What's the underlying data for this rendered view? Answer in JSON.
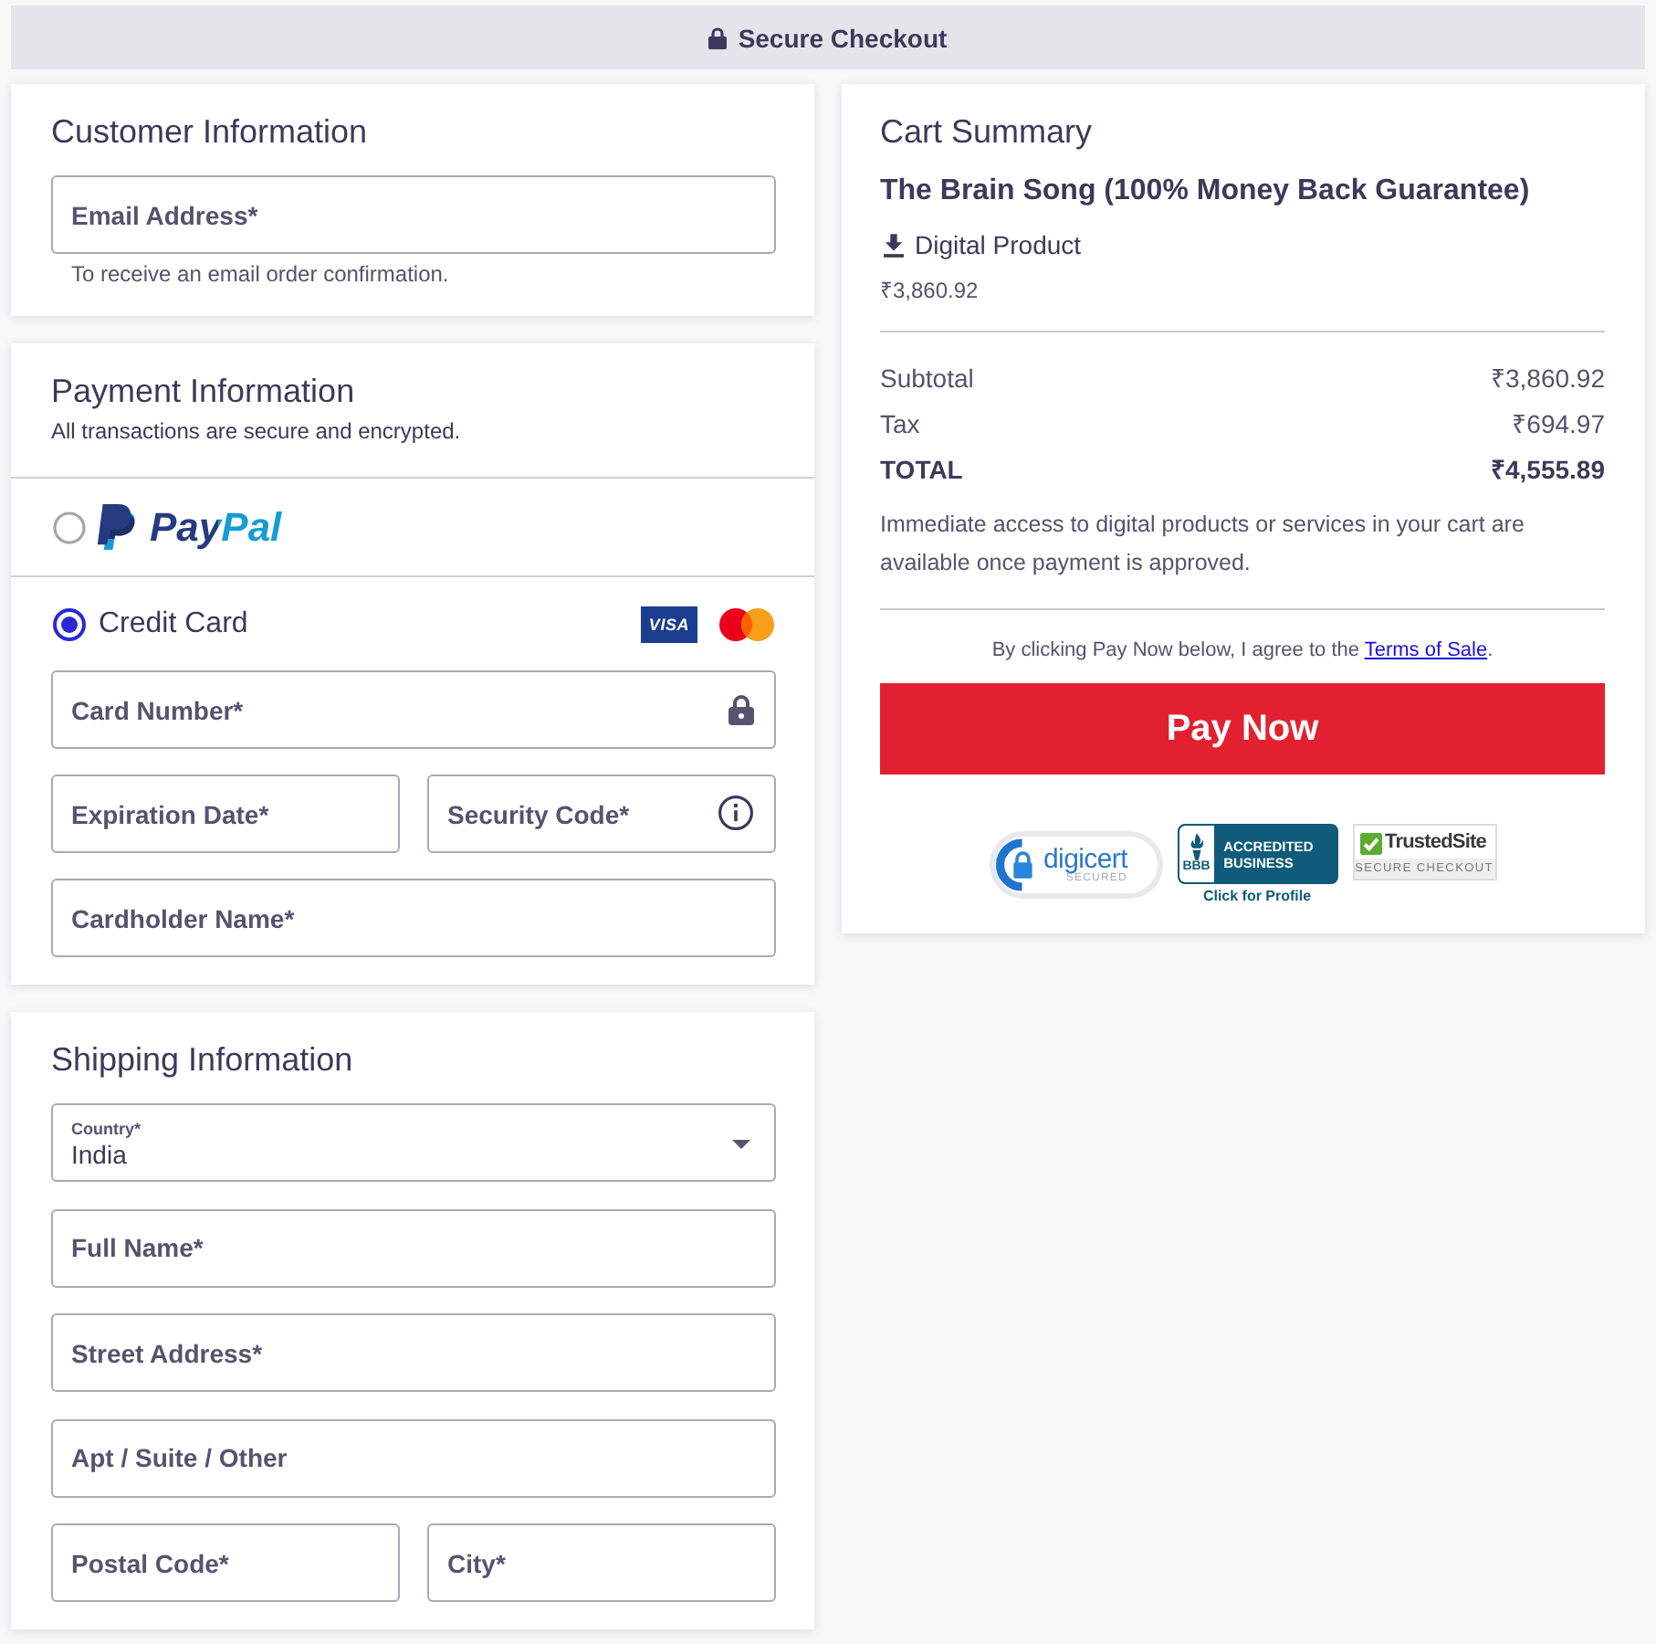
{
  "header": {
    "title": "Secure Checkout"
  },
  "customer": {
    "title": "Customer Information",
    "rows": [
      {
        "fields": [
          {
            "kind": "text",
            "placeholder": "Email Address*"
          }
        ]
      }
    ],
    "hint": "To receive an email order confirmation."
  },
  "payment": {
    "title": "Payment Information",
    "subtitle": "All transactions are secure and encrypted.",
    "methods": [
      {
        "kind": "paypal",
        "label": "PayPal",
        "selected": false
      },
      {
        "kind": "card",
        "label": "Credit Card",
        "selected": true,
        "brands": [
          {
            "kind": "visa",
            "label": "VISA"
          },
          {
            "kind": "mastercard"
          }
        ],
        "rows": [
          {
            "fields": [
              {
                "kind": "card_number",
                "placeholder": "Card Number*"
              }
            ]
          },
          {
            "fields": [
              {
                "kind": "text",
                "placeholder": "Expiration Date*"
              },
              {
                "kind": "security_code",
                "placeholder": "Security Code*"
              }
            ]
          },
          {
            "fields": [
              {
                "kind": "text",
                "placeholder": "Cardholder Name*"
              }
            ]
          }
        ]
      }
    ]
  },
  "shipping": {
    "title": "Shipping Information",
    "rows": [
      {
        "fields": [
          {
            "kind": "select",
            "label": "Country*",
            "value": "India"
          }
        ]
      },
      {
        "fields": [
          {
            "kind": "text",
            "placeholder": "Full Name*"
          }
        ]
      },
      {
        "fields": [
          {
            "kind": "text",
            "placeholder": "Street Address*"
          }
        ]
      },
      {
        "fields": [
          {
            "kind": "text",
            "placeholder": "Apt / Suite / Other"
          }
        ]
      },
      {
        "fields": [
          {
            "kind": "text",
            "placeholder": "Postal Code*"
          },
          {
            "kind": "text",
            "placeholder": "City*"
          }
        ]
      }
    ]
  },
  "cart": {
    "title": "Cart Summary",
    "product": {
      "name": "The Brain Song (100% Money Back Guarantee)",
      "delivery": "Digital Product",
      "price": "₹3,860.92"
    },
    "totals": [
      {
        "kind": "line",
        "label": "Subtotal",
        "amount": "₹3,860.92"
      },
      {
        "kind": "line",
        "label": "Tax",
        "amount": "₹694.97"
      },
      {
        "kind": "total",
        "label": "TOTAL",
        "amount": "₹4,555.89"
      }
    ],
    "note": "Immediate access to digital products or services in your cart are available once payment is approved.",
    "terms": {
      "before": "By clicking Pay Now below, I agree to the ",
      "link": "Terms of Sale",
      "after": "."
    },
    "button": "Pay Now",
    "badges": [
      {
        "kind": "digicert",
        "name": "digicert",
        "caption": "SECURED"
      },
      {
        "kind": "bbb",
        "mark": "BBB",
        "name": "ACCREDITED BUSINESS",
        "caption": "Click for Profile"
      },
      {
        "kind": "trustedsite",
        "name": "TrustedSite",
        "caption": "SECURE CHECKOUT"
      }
    ]
  }
}
